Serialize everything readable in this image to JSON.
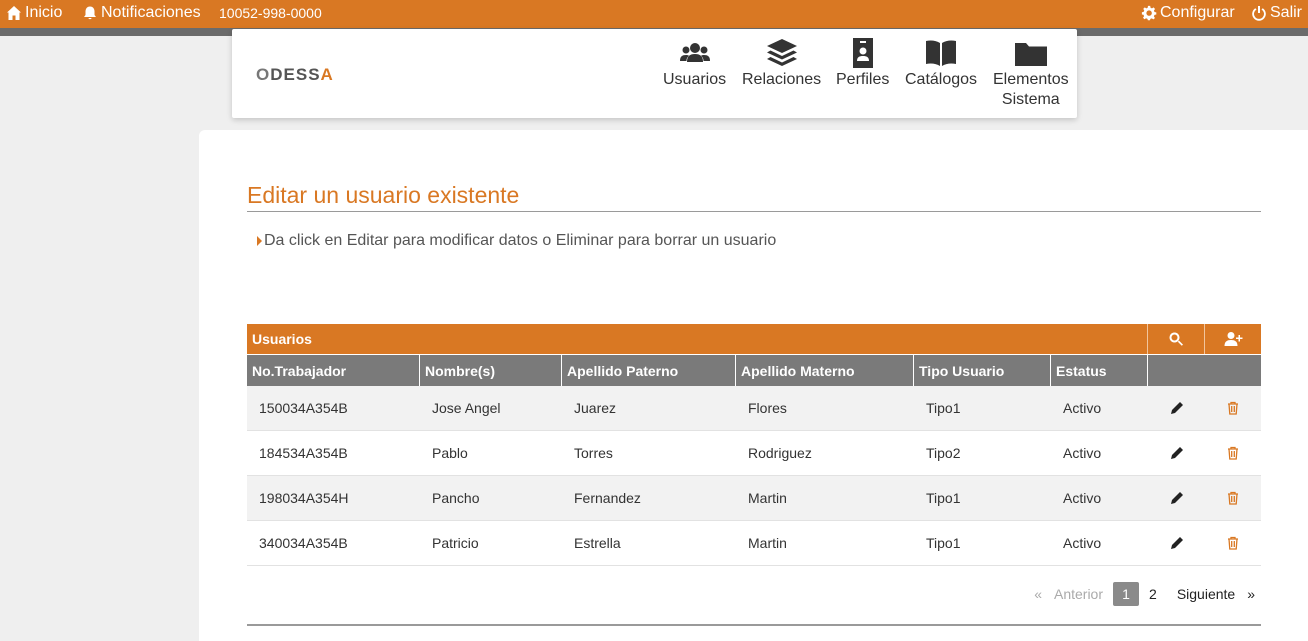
{
  "topbar": {
    "home_label": "Inicio",
    "notifications_label": "Notificaciones",
    "phone": "10052-998-0000",
    "config_label": "Configurar",
    "logout_label": "Salir",
    "bg_color": "#d97823"
  },
  "logo": {
    "text_o": "O",
    "text_dess": "DESS",
    "text_a": "A"
  },
  "nav": {
    "users": "Usuarios",
    "relations": "Relaciones",
    "profiles": "Perfiles",
    "catalogs": "Catálogos",
    "elements_line1": "Elementos",
    "elements_line2": "Sistema"
  },
  "page": {
    "title": "Editar un usuario existente",
    "hint": "Da click en Editar para modificar datos o Eliminar para borrar un usuario",
    "accent_color": "#d97823"
  },
  "table": {
    "caption": "Usuarios",
    "columns": [
      "No.Trabajador",
      "Nombre(s)",
      "Apellido Paterno",
      "Apellido Materno",
      "Tipo Usuario",
      "Estatus"
    ],
    "rows": [
      [
        "150034A354B",
        "Jose Angel",
        "Juarez",
        "Flores",
        "Tipo1",
        "Activo"
      ],
      [
        "184534A354B",
        "Pablo",
        "Torres",
        "Rodriguez",
        "Tipo2",
        "Activo"
      ],
      [
        "198034A354H",
        "Pancho",
        "Fernandez",
        "Martin",
        "Tipo1",
        "Activo"
      ],
      [
        "340034A354B",
        "Patricio",
        "Estrella",
        "Martin",
        "Tipo1",
        "Activo"
      ]
    ]
  },
  "pager": {
    "prev_arrow": "«",
    "prev": "Anterior",
    "page1": "1",
    "page2": "2",
    "next": "Siguiente",
    "next_arrow": "»"
  }
}
